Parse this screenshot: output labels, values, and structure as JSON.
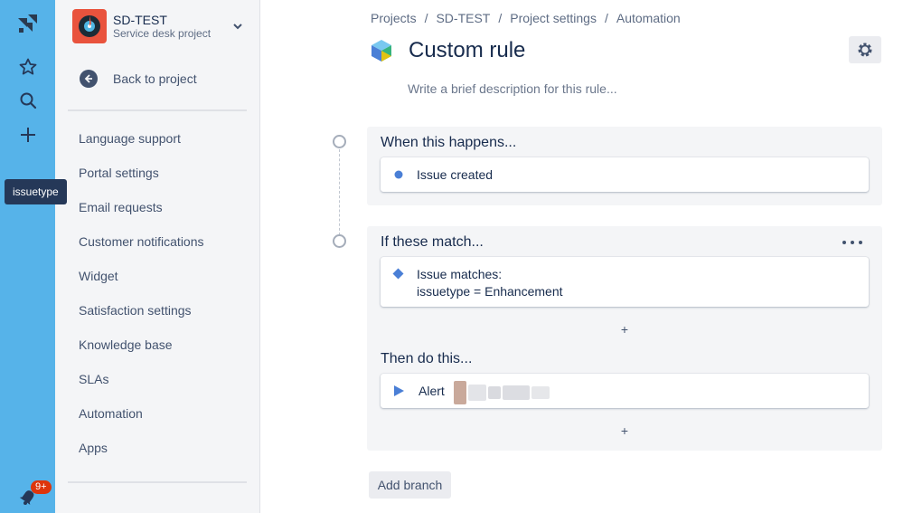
{
  "tooltip": {
    "text": "issuetype"
  },
  "notifications": {
    "badge": "9+"
  },
  "project": {
    "name": "SD-TEST",
    "type": "Service desk project"
  },
  "sidebar": {
    "back_label": "Back to project",
    "items": [
      {
        "label": "Language support"
      },
      {
        "label": "Portal settings"
      },
      {
        "label": "Email requests"
      },
      {
        "label": "Customer notifications"
      },
      {
        "label": "Widget"
      },
      {
        "label": "Satisfaction settings"
      },
      {
        "label": "Knowledge base"
      },
      {
        "label": "SLAs"
      },
      {
        "label": "Automation"
      },
      {
        "label": "Apps"
      }
    ]
  },
  "breadcrumbs": [
    "Projects",
    "SD-TEST",
    "Project settings",
    "Automation"
  ],
  "page": {
    "title": "Custom rule",
    "description_placeholder": "Write a brief description for this rule..."
  },
  "trigger": {
    "section_title": "When this happens...",
    "label": "Issue created"
  },
  "conditions": {
    "section_title": "If these match...",
    "condition_label": "Issue matches:",
    "condition_value": "issuetype = Enhancement"
  },
  "actions": {
    "section_title": "Then do this...",
    "action_label": "Alert"
  },
  "add_symbol": "+",
  "add_branch_label": "Add branch",
  "colors": {
    "global_nav": "#56b3e9",
    "sidebar_bg": "#f4f5f7",
    "trigger_dot": "#4a7fd6",
    "condition_diamond": "#4a7fd6",
    "action_play": "#4a7fd6",
    "badge": "#de350b"
  }
}
